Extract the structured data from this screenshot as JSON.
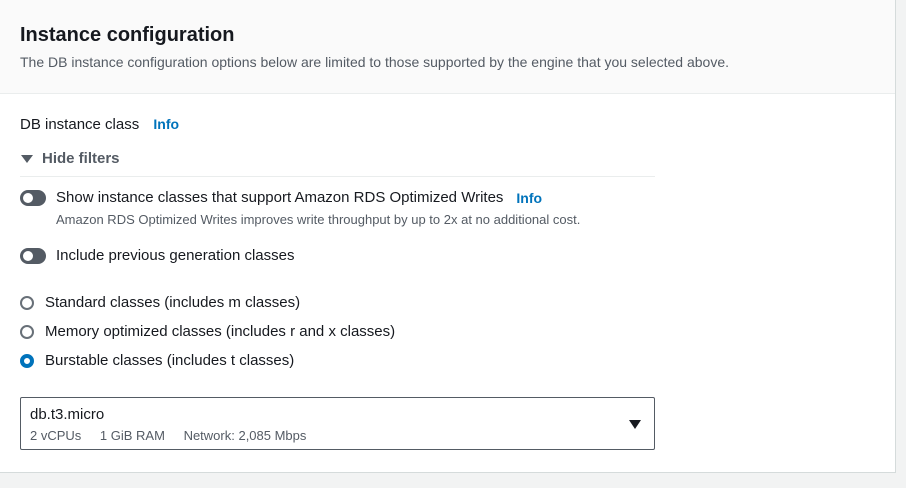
{
  "panel": {
    "title": "Instance configuration",
    "description": "The DB instance configuration options below are limited to those supported by the engine that you selected above."
  },
  "db_instance_class": {
    "label": "DB instance class",
    "info": "Info"
  },
  "filters": {
    "toggle_label": "Hide filters",
    "expanded": true
  },
  "toggles": {
    "optimized_writes": {
      "label": "Show instance classes that support Amazon RDS Optimized Writes",
      "info": "Info",
      "description": "Amazon RDS Optimized Writes improves write throughput by up to 2x at no additional cost.",
      "enabled": false
    },
    "previous_generation": {
      "label": "Include previous generation classes",
      "enabled": false
    }
  },
  "class_options": [
    {
      "label": "Standard classes (includes m classes)",
      "selected": false
    },
    {
      "label": "Memory optimized classes (includes r and x classes)",
      "selected": false
    },
    {
      "label": "Burstable classes (includes t classes)",
      "selected": true
    }
  ],
  "instance_select": {
    "value": "db.t3.micro",
    "vcpus": "2 vCPUs",
    "ram": "1 GiB RAM",
    "network": "Network: 2,085 Mbps"
  },
  "colors": {
    "accent": "#0073bb",
    "toggle_off": "#545b64",
    "text_primary": "#16191f",
    "text_secondary": "#545b64"
  }
}
